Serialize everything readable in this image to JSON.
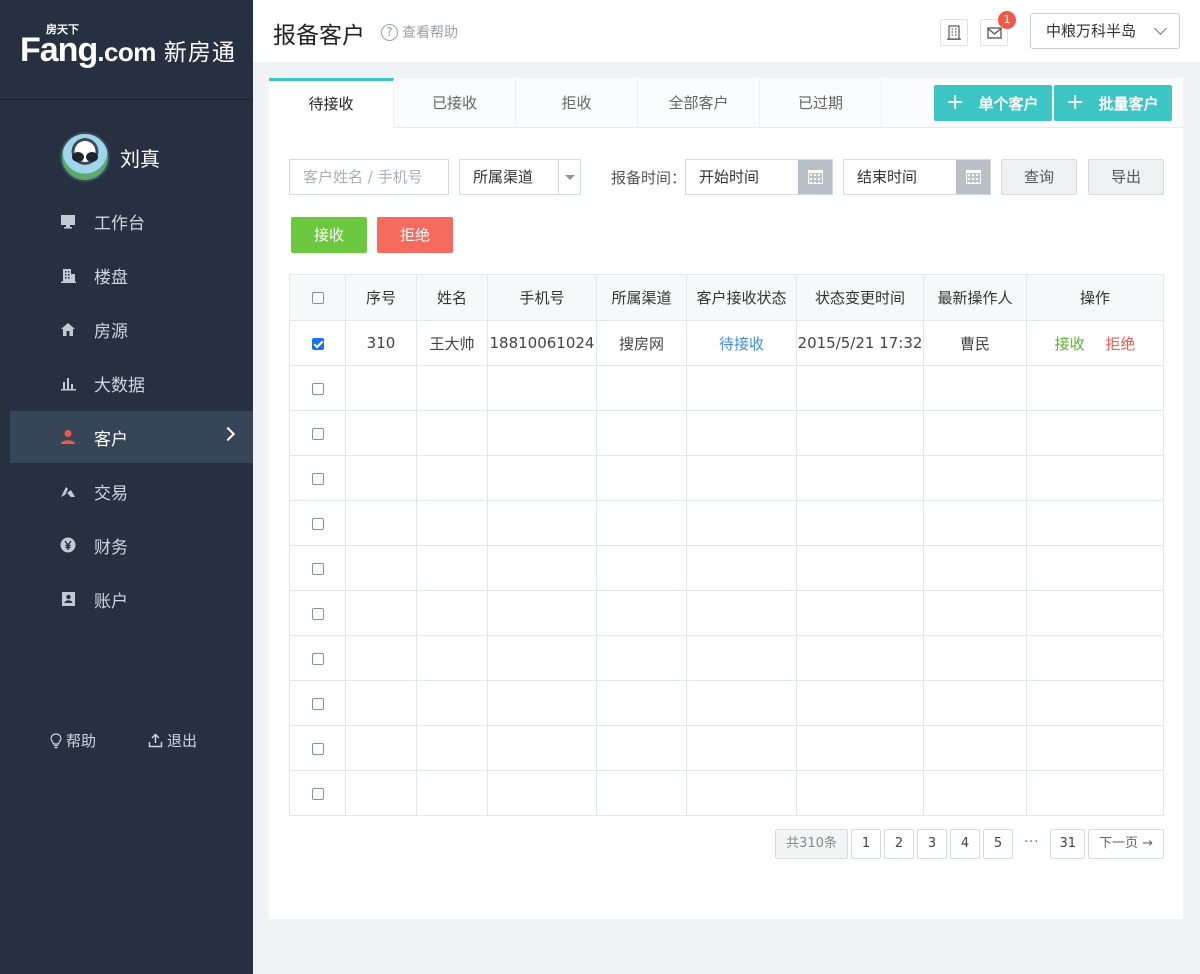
{
  "brand": {
    "logo_tiny": "房天下",
    "logo_main": "Fang",
    "logo_dot": ".com",
    "product": "新房通"
  },
  "user": {
    "name": "刘真"
  },
  "sidebar": {
    "items": [
      {
        "label": "工作台",
        "icon": "monitor-icon"
      },
      {
        "label": "楼盘",
        "icon": "building-icon"
      },
      {
        "label": "房源",
        "icon": "house-icon"
      },
      {
        "label": "大数据",
        "icon": "bar-chart-icon"
      },
      {
        "label": "客户",
        "icon": "person-icon",
        "active": true
      },
      {
        "label": "交易",
        "icon": "handshake-icon"
      },
      {
        "label": "财务",
        "icon": "yen-icon"
      },
      {
        "label": "账户",
        "icon": "account-icon"
      }
    ],
    "footer": {
      "help": "帮助",
      "logout": "退出"
    }
  },
  "header": {
    "title": "报备客户",
    "help": "查看帮助",
    "notification_count": "1",
    "project": "中粮万科半岛"
  },
  "tabs": [
    "待接收",
    "已接收",
    "拒收",
    "全部客户",
    "已过期"
  ],
  "add_buttons": {
    "single": "单个客户",
    "batch": "批量客户"
  },
  "filters": {
    "search_placeholder": "客户姓名 / 手机号",
    "channel": "所属渠道",
    "time_label": "报备时间：",
    "start": "开始时间",
    "end": "结束时间",
    "query": "查询",
    "export": "导出"
  },
  "actions": {
    "accept": "接收",
    "reject": "拒绝"
  },
  "table": {
    "columns": [
      "序号",
      "姓名",
      "手机号",
      "所属渠道",
      "客户接收状态",
      "状态变更时间",
      "最新操作人",
      "操作"
    ],
    "rows": [
      {
        "checked": true,
        "no": "310",
        "name": "王大帅",
        "phone": "18810061024",
        "channel": "搜房网",
        "status": "待接收",
        "changed_at": "2015/5/21 17:32",
        "operator": "曹民",
        "op_accept": "接收",
        "op_reject": "拒绝"
      }
    ],
    "empty_rows": 10
  },
  "pagination": {
    "total": "共310条",
    "pages": [
      "1",
      "2",
      "3",
      "4",
      "5"
    ],
    "ellipsis": "···",
    "last": "31",
    "next": "下一页 →"
  },
  "colors": {
    "sidebar_bg": "#263040",
    "accent": "#3cc5c2",
    "accept": "#6cc83f",
    "reject": "#f46b5d",
    "link": "#3c8fe0"
  }
}
